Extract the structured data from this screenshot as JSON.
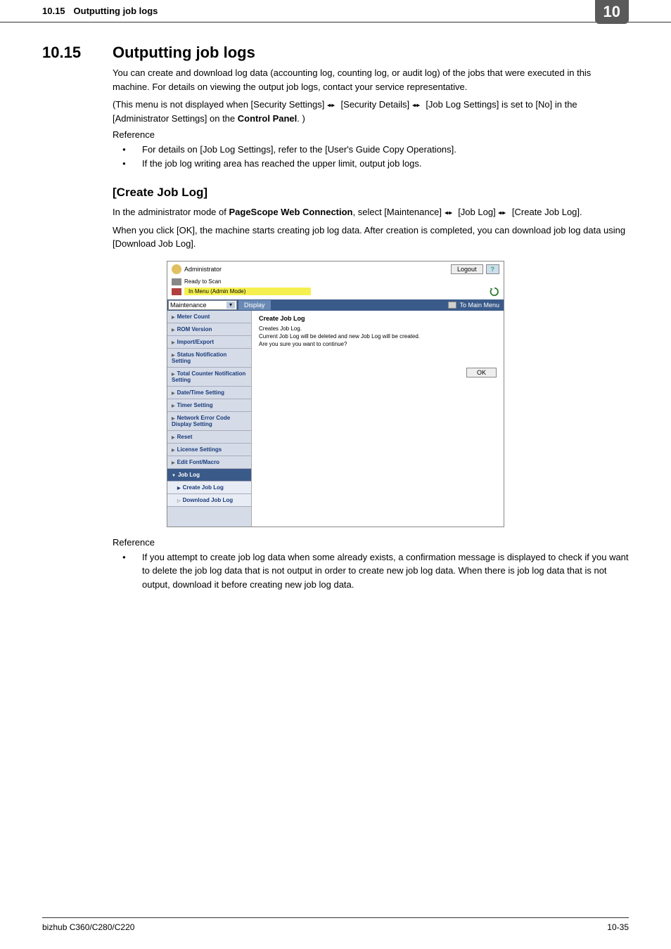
{
  "header": {
    "section_num": "10.15",
    "title": "Outputting job logs",
    "chapter": "10"
  },
  "section": {
    "num": "10.15",
    "heading": "Outputting job logs",
    "para1": "You can create and download log data (accounting log, counting log, or audit log) of the jobs that were executed in this machine. For details on viewing the output job logs, contact your service representative.",
    "para2a": "(This menu is not displayed when [Security Settings] ",
    "para2b": " [Security Details] ",
    "para2c": " [Job Log Settings] is set to [No] in the [Administrator Settings] on the ",
    "para2d": "Control Panel",
    "para2e": ". )",
    "ref_label": "Reference",
    "bullets": [
      "For details on [Job Log Settings], refer to the [User's Guide Copy Operations].",
      "If the job log writing area has reached the upper limit, output job logs."
    ]
  },
  "subsection": {
    "heading": "[Create Job Log]",
    "para1a": "In the administrator mode of ",
    "para1b": "PageScope Web Connection",
    "para1c": ", select [Maintenance] ",
    "para1d": " [Job Log] ",
    "para1e": " [Create Job Log].",
    "para2": "When you click [OK], the machine starts creating job log data. After creation is completed, you can download job log data using [Download Job Log]."
  },
  "screenshot": {
    "admin_text": "Administrator",
    "logout": "Logout",
    "help": "?",
    "status": "Ready to Scan",
    "mode": "In Menu (Admin Mode)",
    "select": "Maintenance",
    "display_btn": "Display",
    "main_menu": "To Main Menu",
    "sidebar": {
      "meter": "Meter Count",
      "rom": "ROM Version",
      "import": "Import/Export",
      "status_notif": "Status Notification Setting",
      "total_counter": "Total Counter Notification Setting",
      "datetime": "Date/Time Setting",
      "timer": "Timer Setting",
      "network_err": "Network Error Code Display Setting",
      "reset": "Reset",
      "license": "License Settings",
      "edit_font": "Edit Font/Macro",
      "job_log": "Job Log",
      "create_job": "Create Job Log",
      "download_job": "Download Job Log"
    },
    "main": {
      "title": "Create Job Log",
      "line1": "Creates Job Log.",
      "line2": "Current Job Log will be deleted and new Job Log will be created.",
      "line3": "Are you sure you want to continue?",
      "ok": "OK"
    }
  },
  "reference2": {
    "label": "Reference",
    "bullet": "If you attempt to create job log data when some already exists, a confirmation message is displayed to check if you want to delete the job log data that is not output in order to create new job log data. When there is job log data that is not output, download it before creating new job log data."
  },
  "footer": {
    "left": "bizhub C360/C280/C220",
    "right": "10-35"
  }
}
